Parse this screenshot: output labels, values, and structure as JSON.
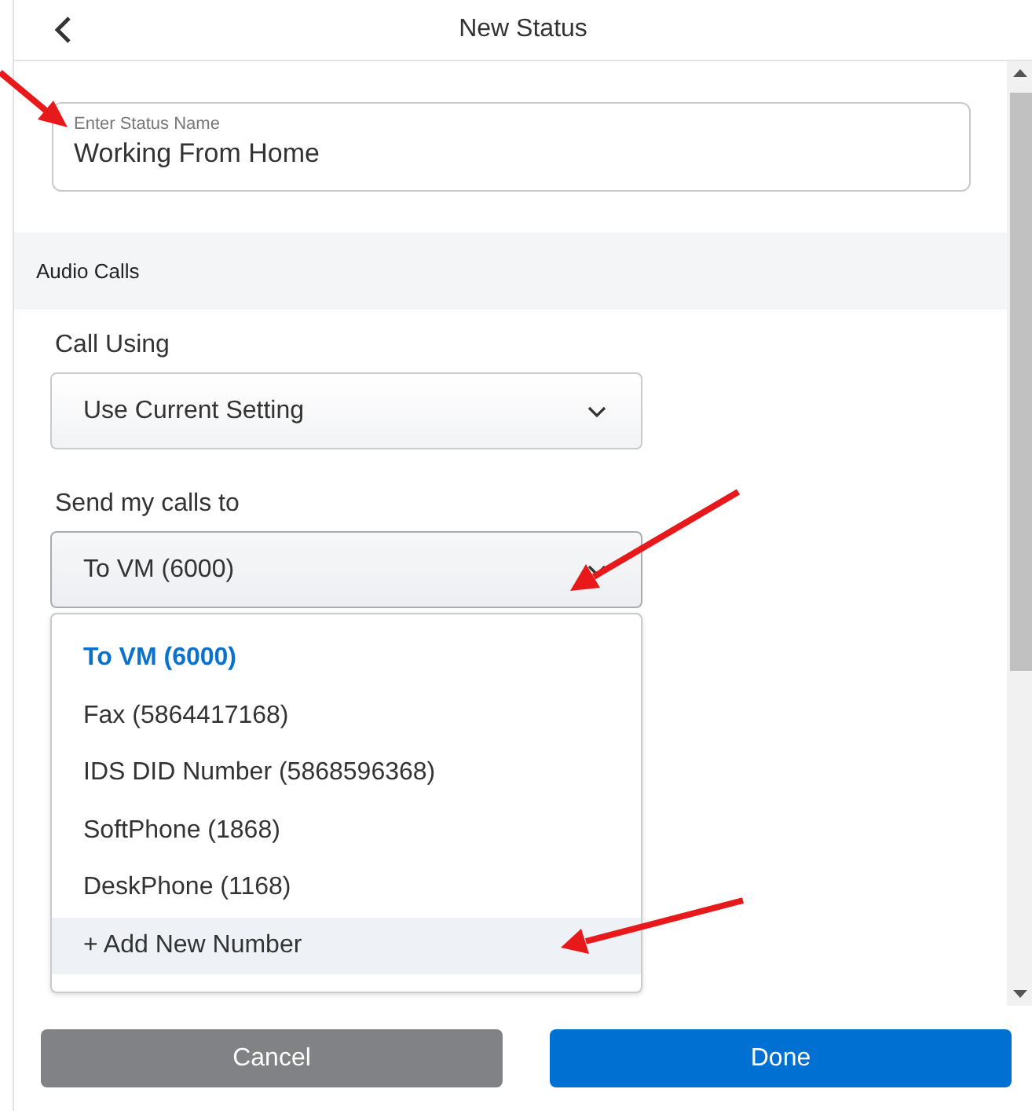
{
  "header": {
    "title": "New Status"
  },
  "status_name": {
    "label": "Enter Status Name",
    "value": "Working From Home"
  },
  "section": {
    "title": "Audio Calls"
  },
  "call_using": {
    "label": "Call Using",
    "value": "Use Current Setting"
  },
  "send_calls_to": {
    "label": "Send my calls to",
    "value": "To VM (6000)",
    "expanded": true,
    "options": [
      {
        "label": "To VM (6000)",
        "selected": true,
        "hovered": false
      },
      {
        "label": "Fax (5864417168)",
        "selected": false,
        "hovered": false
      },
      {
        "label": "IDS DID Number (5868596368)",
        "selected": false,
        "hovered": false
      },
      {
        "label": "SoftPhone (1868)",
        "selected": false,
        "hovered": false
      },
      {
        "label": "DeskPhone (1168)",
        "selected": false,
        "hovered": false
      },
      {
        "label": "+ Add New Number",
        "selected": false,
        "hovered": true
      }
    ]
  },
  "buttons": [
    {
      "label": "Cancel",
      "kind": "secondary"
    },
    {
      "label": "Done",
      "kind": "primary"
    }
  ]
}
